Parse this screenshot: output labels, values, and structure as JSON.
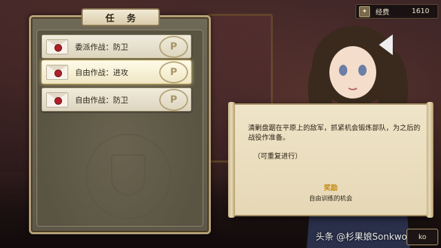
{
  "panel": {
    "title": "任务"
  },
  "quests": [
    {
      "label": "委派作战：防卫",
      "selected": false
    },
    {
      "label": "自由作战：进攻",
      "selected": true
    },
    {
      "label": "自由作战：防卫",
      "selected": false
    }
  ],
  "currency": {
    "icon": "coin-icon",
    "label": "经费",
    "value": "1610"
  },
  "detail": {
    "description": "清剿盘踞在平原上的敌军，抓紧机会锻炼部队，为之后的战役作准备。",
    "note": "（可重复进行）",
    "reward_title": "奖励",
    "reward_value": "自由训练的机会"
  },
  "back_button": {
    "label": "ko"
  },
  "watermark": "头条 @杉果娘Sonkwo",
  "colors": {
    "accent_gold": "#c48a10",
    "seal_red": "#b0202a",
    "panel_border": "#b7a27a"
  }
}
